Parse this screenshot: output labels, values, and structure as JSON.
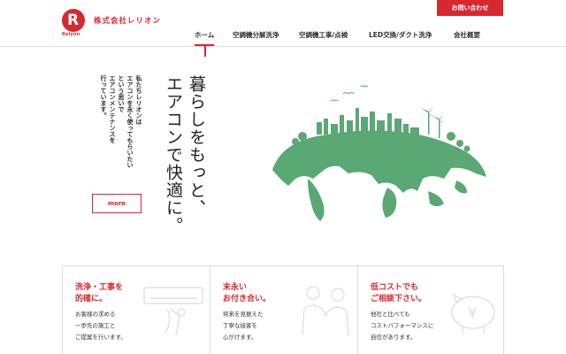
{
  "header": {
    "logo_letter": "R",
    "logo_sub": "Reiyon",
    "company_name": "株式会社レリオン",
    "contact_label": "お問い合わせ"
  },
  "nav": {
    "items": [
      {
        "label": "ホーム",
        "active": true
      },
      {
        "label": "空調機分解洗浄",
        "active": false
      },
      {
        "label": "空調機工事/点検",
        "active": false
      },
      {
        "label": "LED交換/ダクト洗浄",
        "active": false
      },
      {
        "label": "会社概要",
        "active": false
      }
    ]
  },
  "hero": {
    "tagline_lines": [
      "私たちレリオンは",
      "エアコンを永く使ってもらいたい",
      "という思いで",
      "エアコンメンテナンスを",
      "行っています。"
    ],
    "headline_lines": [
      "暮らしをもっと、",
      "エアコンで快適に。"
    ],
    "more_label": "more"
  },
  "features": [
    {
      "title": "洗浄・工事を\n的確に。",
      "body": "お客様の求める\n一歩先の施工と\nご提案を行います。",
      "illustration": "air-conditioner-illustration"
    },
    {
      "title": "末永い\nお付き合い。",
      "body": "将来を見据えた\n丁寧な接客を\n心がけます。",
      "illustration": "handshake-illustration"
    },
    {
      "title": "低コストでも\nご相談下さい。",
      "body": "他社と比べても\nコストパフォーマンスに\n自信があります。",
      "illustration": "piggy-bank-illustration"
    }
  ],
  "colors": {
    "accent": "#d7282f",
    "globe_green": "#5aa874"
  }
}
